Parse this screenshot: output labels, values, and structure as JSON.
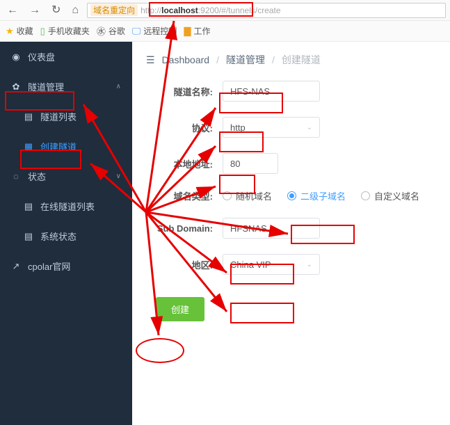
{
  "browser": {
    "redirect_label": "域名重定向",
    "url_prefix": "http://",
    "url_host": "localhost",
    "url_rest": ":9200/#/tunnels/create"
  },
  "bookmarks": {
    "fav": "收藏",
    "mobile": "手机收藏夹",
    "google": "谷歌",
    "remote": "远程控制",
    "work": "工作"
  },
  "sidebar": {
    "dashboard": "仪表盘",
    "tunnel_mgmt": "隧道管理",
    "tunnel_list": "隧道列表",
    "tunnel_create": "创建隧道",
    "status": "状态",
    "online_list": "在线隧道列表",
    "sys_status": "系统状态",
    "cpolar": "cpolar官网"
  },
  "breadcrumb": {
    "dash": "Dashboard",
    "mgmt": "隧道管理",
    "create": "创建隧道"
  },
  "form": {
    "name_label": "隧道名称:",
    "name_value": "HFS-NAS",
    "proto_label": "协议:",
    "proto_value": "http",
    "addr_label": "本地地址:",
    "addr_value": "80",
    "domain_type_label": "域名类型:",
    "radio_random": "随机域名",
    "radio_sub": "二级子域名",
    "radio_custom": "自定义域名",
    "sub_label": "Sub Domain:",
    "sub_value": "HFSNAS",
    "region_label": "地区:",
    "region_value": "China VIP",
    "submit": "创建"
  }
}
